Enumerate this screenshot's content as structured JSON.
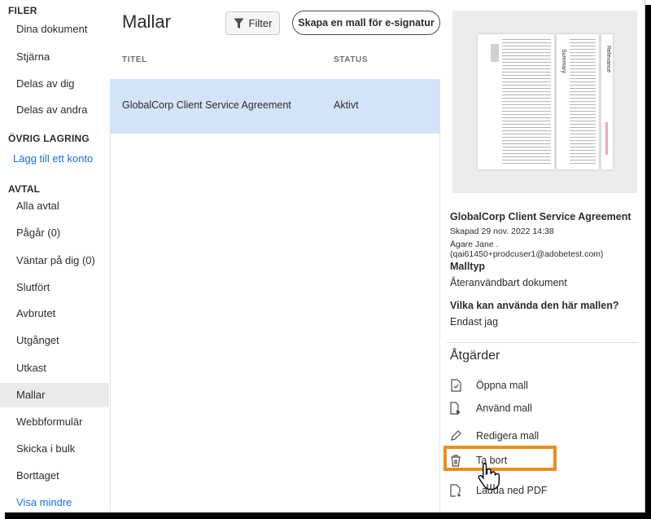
{
  "sidebar": {
    "files_heading": "FILER",
    "files_items": [
      "Dina dokument",
      "Stjärna",
      "Delas av dig",
      "Delas av andra"
    ],
    "storage_heading": "ÖVRIG LAGRING",
    "add_account": "Lägg till ett konto",
    "agreements_heading": "AVTAL",
    "agreement_items": [
      "Alla avtal",
      "Pågår (0)",
      "Väntar på dig (0)",
      "Slutfört",
      "Avbrutet",
      "Utgånget",
      "Utkast",
      "Mallar",
      "Webbformulär",
      "Skicka i bulk",
      "Borttaget"
    ],
    "show_less": "Visa mindre",
    "active_item": "Mallar"
  },
  "main": {
    "title": "Mallar",
    "filter_label": "Filter",
    "create_label": "Skapa en mall för e-signatur",
    "columns": {
      "title": "TITEL",
      "status": "STATUS"
    },
    "rows": [
      {
        "title": "GlobalCorp Client Service Agreement",
        "status": "Aktivt"
      }
    ]
  },
  "panel": {
    "doc_title": "GlobalCorp Client Service Agreement",
    "created": "Skapad 29 nov. 2022 14:38",
    "owner": "Ägare Jane . (qai61450+prodcuser1@adobetest.com)",
    "type_heading": "Malltyp",
    "type_value": "Återanvändbart dokument",
    "who_heading": "Vilka kan använda den här mallen?",
    "who_value": "Endast jag",
    "actions_heading": "Åtgärder",
    "actions": [
      {
        "label": "Öppna mall",
        "icon": "open-doc-icon"
      },
      {
        "label": "Använd mall",
        "icon": "use-template-icon"
      },
      {
        "label": "Redigera mall",
        "icon": "pencil-icon"
      },
      {
        "label": "Ta bort",
        "icon": "trash-icon"
      },
      {
        "label": "Ladda ned PDF",
        "icon": "download-pdf-icon"
      }
    ],
    "preview_page_labels": [
      "Summary",
      "Relevance"
    ]
  },
  "colors": {
    "accent": "#1473e6",
    "selected_row": "#d3e4f8",
    "highlight": "#f08c1d"
  }
}
